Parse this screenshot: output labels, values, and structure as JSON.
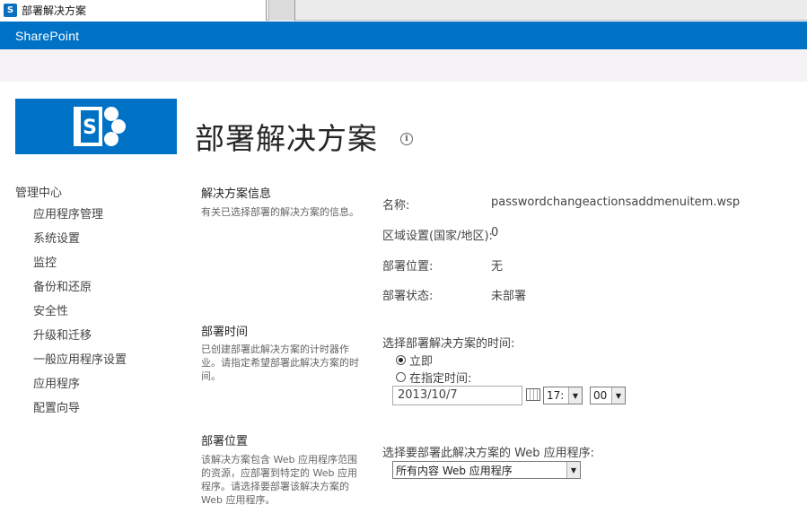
{
  "browser": {
    "tab_title": "部署解决方案",
    "tab_icon_letter": "S"
  },
  "suite": {
    "brand": "SharePoint"
  },
  "logo": {
    "letter": "S"
  },
  "page": {
    "title": "部署解决方案",
    "info_icon_glyph": "i"
  },
  "nav": {
    "heading": "管理中心",
    "items": [
      "应用程序管理",
      "系统设置",
      "监控",
      "备份和还原",
      "安全性",
      "升级和迁移",
      "一般应用程序设置",
      "应用程序",
      "配置向导"
    ]
  },
  "sections": {
    "info": {
      "title": "解决方案信息",
      "description": "有关已选择部署的解决方案的信息。",
      "name_label": "名称:",
      "name_value": "passwordchangeactionsaddmenuitem.wsp",
      "locale_label": "区域设置(国家/地区):",
      "locale_value": "0",
      "location_label": "部署位置:",
      "location_value": "无",
      "status_label": "部署状态:",
      "status_value": "未部署"
    },
    "time": {
      "title": "部署时间",
      "description": "已创建部署此解决方案的计时器作业。请指定希望部署此解决方案的时间。",
      "prompt": "选择部署解决方案的时间:",
      "option_now": "立即",
      "option_specific": "在指定时间:",
      "selected": "now",
      "date_value": "2013/10/7",
      "hour_value": "17:",
      "minute_value": "00"
    },
    "location": {
      "title": "部署位置",
      "description": "该解决方案包含 Web 应用程序范围的资源，应部署到特定的 Web 应用程序。请选择要部署该解决方案的 Web 应用程序。",
      "prompt": "选择要部署此解决方案的 Web 应用程序:",
      "webapp_selected": "所有内容 Web 应用程序"
    }
  },
  "colors": {
    "suite_blue": "#0072c6",
    "ribbon_bg": "#f4f2f5"
  }
}
